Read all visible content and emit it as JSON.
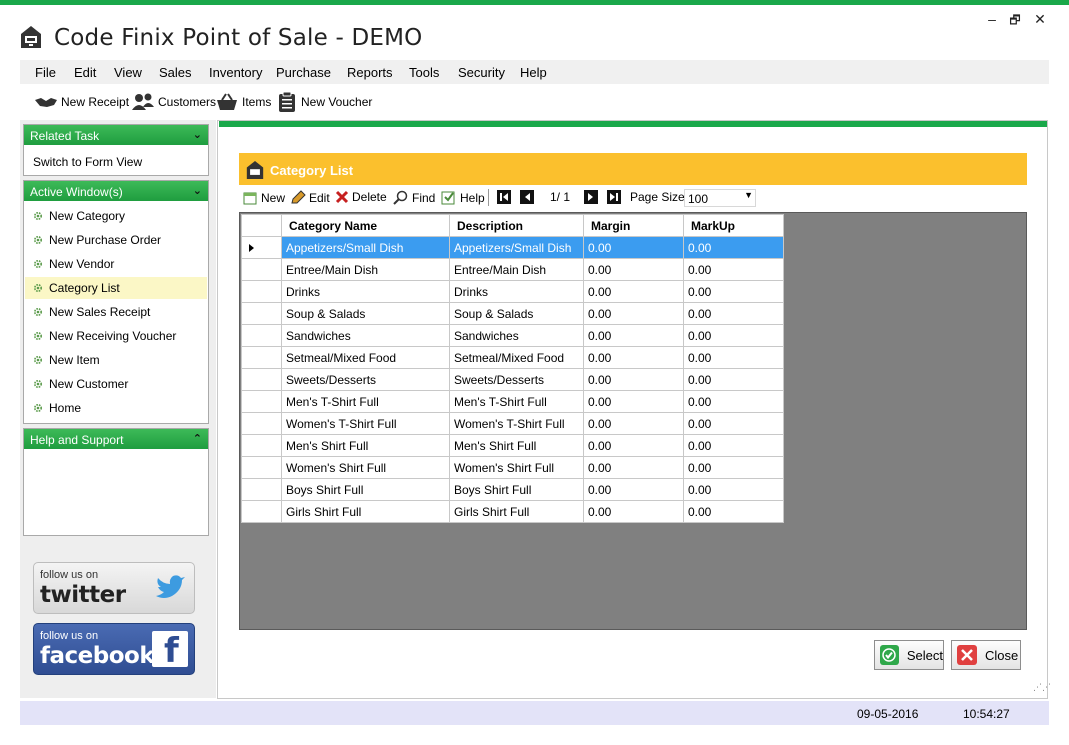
{
  "window": {
    "title": "Code Finix Point of Sale - DEMO",
    "minimize": "–",
    "restore": "🗗",
    "close": "✕"
  },
  "menu": [
    "File",
    "Edit",
    "View",
    "Sales",
    "Inventory",
    "Purchase",
    "Reports",
    "Tools",
    "Security",
    "Help"
  ],
  "toolbar": {
    "new_receipt": "New Receipt",
    "customers": "Customers",
    "items": "Items",
    "new_voucher": "New Voucher"
  },
  "sidebar": {
    "related_task": {
      "title": "Related Task",
      "link": "Switch to Form View"
    },
    "active_windows": {
      "title": "Active Window(s)",
      "items": [
        "New Category",
        "New Purchase Order",
        "New Vendor",
        "Category List",
        "New Sales Receipt",
        "New Receiving Voucher",
        "New Item",
        "New Customer",
        "Home"
      ],
      "active_index": 3
    },
    "help": {
      "title": "Help and Support"
    },
    "twitter": {
      "small": "follow us on",
      "big": "twitter"
    },
    "facebook": {
      "small": "follow us on",
      "big": "facebook",
      "logo_letter": "f"
    }
  },
  "form": {
    "title": "Category List",
    "nav": {
      "new": "New",
      "edit": "Edit",
      "delete": "Delete",
      "find": "Find",
      "help": "Help",
      "page": "1/ 1",
      "page_size_label": "Page Size",
      "page_size_value": "100"
    },
    "grid": {
      "columns": [
        "Category Name",
        "Description",
        "Margin",
        "MarkUp"
      ],
      "rows": [
        [
          "Appetizers/Small Dish",
          "Appetizers/Small Dish",
          "0.00",
          "0.00"
        ],
        [
          "Entree/Main Dish",
          "Entree/Main Dish",
          "0.00",
          "0.00"
        ],
        [
          "Drinks",
          "Drinks",
          "0.00",
          "0.00"
        ],
        [
          "Soup & Salads",
          "Soup & Salads",
          "0.00",
          "0.00"
        ],
        [
          "Sandwiches",
          "Sandwiches",
          "0.00",
          "0.00"
        ],
        [
          "Setmeal/Mixed Food",
          "Setmeal/Mixed Food",
          "0.00",
          "0.00"
        ],
        [
          "Sweets/Desserts",
          "Sweets/Desserts",
          "0.00",
          "0.00"
        ],
        [
          "Men's T-Shirt Full",
          "Men's T-Shirt Full",
          "0.00",
          "0.00"
        ],
        [
          "Women's T-Shirt Full",
          "Women's T-Shirt Full",
          "0.00",
          "0.00"
        ],
        [
          "Men's Shirt Full",
          "Men's Shirt Full",
          "0.00",
          "0.00"
        ],
        [
          "Women's Shirt Full",
          "Women's Shirt Full",
          "0.00",
          "0.00"
        ],
        [
          "Boys Shirt Full",
          "Boys Shirt Full",
          "0.00",
          "0.00"
        ],
        [
          "Girls Shirt Full",
          "Girls Shirt Full",
          "0.00",
          "0.00"
        ]
      ],
      "selected_row": 0
    },
    "buttons": {
      "select": "Select",
      "close": "Close"
    }
  },
  "status": {
    "date": "09-05-2016",
    "time": "10:54:27"
  },
  "colors": {
    "accent_green": "#1aa84a",
    "header_yellow": "#fbc02d",
    "selection_blue": "#3b9cf0",
    "status_bg": "#e3e3f8"
  }
}
